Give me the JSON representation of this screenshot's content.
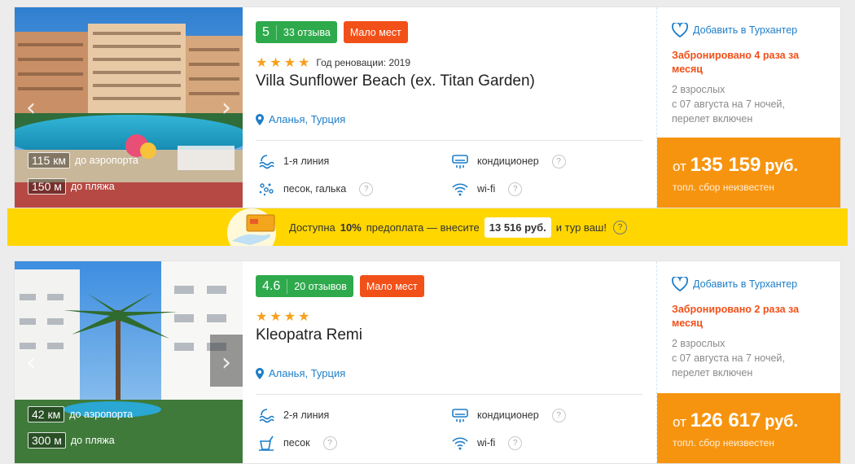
{
  "hotels": [
    {
      "score": "5",
      "reviews": "33 отзыва",
      "few_label": "Мало мест",
      "stars": 4,
      "renovation": "Год реновации: 2019",
      "name": "Villa Sunflower Beach (ex. Titan Garden)",
      "location": "Аланья, Турция",
      "airport_km": "115 км",
      "airport_label": "до аэропорта",
      "beach_m": "150 м",
      "beach_label": "до пляжа",
      "features": [
        "1-я линия",
        "кондиционер",
        "песок, галька",
        "wi-fi"
      ],
      "fav": "Добавить в Турхантер",
      "booked": "Забронировано 4 раза за месяц",
      "guests": "2 взрослых",
      "dates": "с 07 августа на 7 ночей,",
      "flight": "перелет включен",
      "price_from": "от",
      "price": "135 159",
      "currency": "руб.",
      "fee": "топл. сбор неизвестен"
    },
    {
      "score": "4.6",
      "reviews": "20 отзывов",
      "few_label": "Мало мест",
      "stars": 4,
      "renovation": "",
      "name": "Kleopatra Remi",
      "location": "Аланья, Турция",
      "airport_km": "42 км",
      "airport_label": "до аэропорта",
      "beach_m": "300 м",
      "beach_label": "до пляжа",
      "features": [
        "2-я линия",
        "кондиционер",
        "песок",
        "wi-fi"
      ],
      "fav": "Добавить в Турхантер",
      "booked": "Забронировано 2 раза за месяц",
      "guests": "2 взрослых",
      "dates": "с 07 августа на 7 ночей,",
      "flight": "перелет включен",
      "price_from": "от",
      "price": "126 617",
      "currency": "руб.",
      "fee": "топл. сбор неизвестен"
    }
  ],
  "prepay": {
    "pre": "Доступна",
    "percent": "10%",
    "mid": "предоплата — внесите",
    "amount": "13 516 руб.",
    "post": "и тур ваш!",
    "help": "?"
  },
  "arrows": {
    "left": "‹",
    "right": "›"
  },
  "help_mark": "?",
  "colors": {
    "rating": "#2eaa4c",
    "few": "#f25019",
    "price": "#f7940f",
    "prepay": "#ffd600",
    "link": "#1e7ec8"
  }
}
